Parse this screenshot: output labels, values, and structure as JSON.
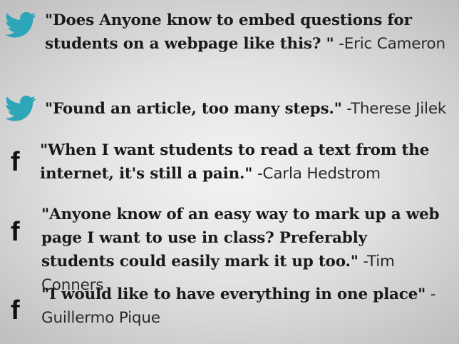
{
  "colors": {
    "twitter_blue": "#2ca6b8",
    "facebook_black": "#111111",
    "text": "#1a1a1a"
  },
  "quotes": [
    {
      "source_icon": "twitter-icon",
      "text": "\"Does Anyone know to embed questions for students on a webpage like this? \"",
      "author": "-Eric Cameron"
    },
    {
      "source_icon": "twitter-icon",
      "text": "\"Found an article, too many steps.\"",
      "author": "-Therese Jilek"
    },
    {
      "source_icon": "facebook-icon",
      "text": "\"When I want students to read a text from the internet, it's still a pain.\"",
      "author": "-Carla Hedstrom"
    },
    {
      "source_icon": "facebook-icon",
      "text": "\"Anyone know of an easy way to mark up a web page I want to use in class? Preferably students could easily mark it up too.\"",
      "author": "-Tim Conners"
    },
    {
      "source_icon": "facebook-icon",
      "text": "\"I would like to have everything in one place\"",
      "author": "- Guillermo Pique"
    }
  ]
}
